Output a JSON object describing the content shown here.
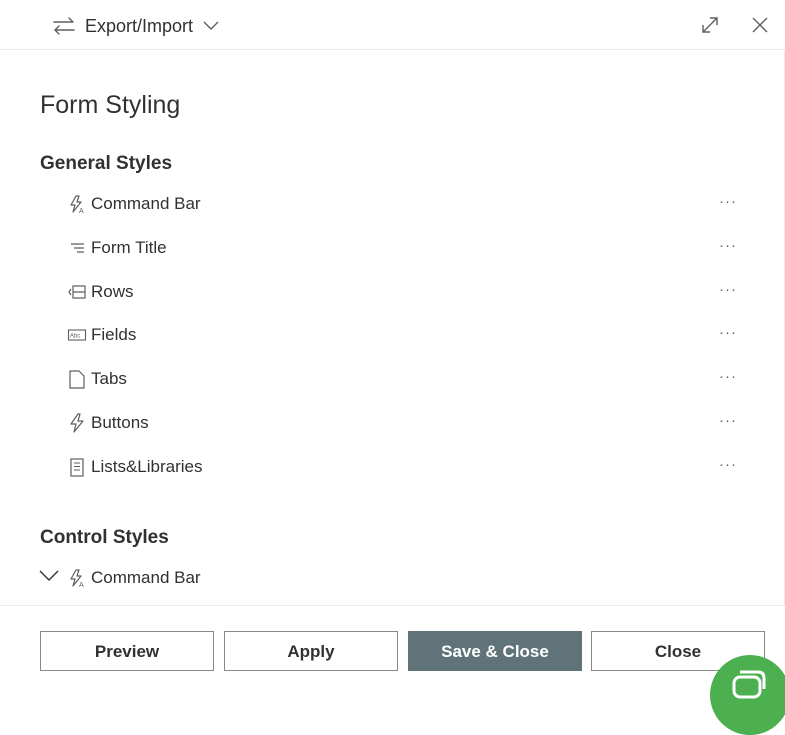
{
  "header": {
    "export_import_label": "Export/Import"
  },
  "page": {
    "title": "Form Styling"
  },
  "general_styles": {
    "title": "General Styles",
    "items": [
      {
        "label": "Command Bar",
        "icon": "command-bar-icon",
        "more": "···"
      },
      {
        "label": "Form Title",
        "icon": "form-title-icon",
        "more": "···"
      },
      {
        "label": "Rows",
        "icon": "rows-icon",
        "more": "···"
      },
      {
        "label": "Fields",
        "icon": "fields-icon",
        "more": "···"
      },
      {
        "label": "Tabs",
        "icon": "tabs-icon",
        "more": "···"
      },
      {
        "label": "Buttons",
        "icon": "buttons-icon",
        "more": "···"
      },
      {
        "label": "Lists&Libraries",
        "icon": "lists-libraries-icon",
        "more": "···"
      }
    ]
  },
  "control_styles": {
    "title": "Control Styles",
    "items": [
      {
        "label": "Command Bar",
        "icon": "command-bar-icon",
        "expanded": true
      }
    ]
  },
  "footer": {
    "preview": "Preview",
    "apply": "Apply",
    "save_close": "Save & Close",
    "close": "Close"
  },
  "colors": {
    "primary_button": "#5f7378",
    "chat_bubble": "#4caf50"
  }
}
